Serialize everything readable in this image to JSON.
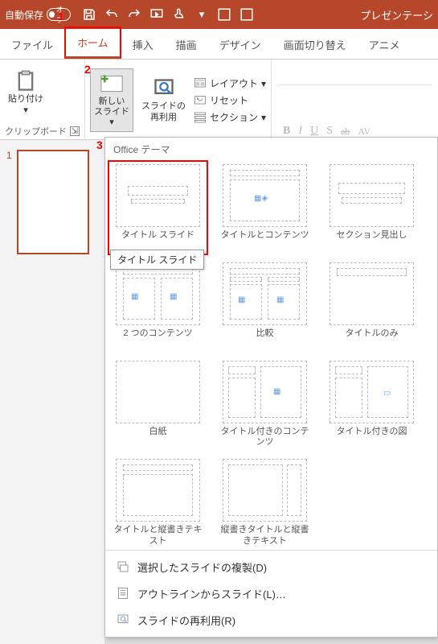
{
  "titlebar": {
    "autosave_label": "自動保存",
    "autosave_state": "オフ",
    "presentation_label": "プレゼンテーシ"
  },
  "callouts": {
    "c1": "1",
    "c2": "2",
    "c3": "3"
  },
  "tabs": {
    "file": "ファイル",
    "home": "ホーム",
    "insert": "挿入",
    "draw": "描画",
    "design": "デザイン",
    "transitions": "画面切り替え",
    "animations": "アニメ"
  },
  "ribbon": {
    "clipboard": {
      "title": "クリップボード",
      "paste": "貼り付け"
    },
    "slides": {
      "new_slide": "新しい\nスライド",
      "reuse": "スライドの\n再利用",
      "layout": "レイアウト",
      "reset": "リセット",
      "section": "セクション"
    },
    "font": {
      "b": "B",
      "i": "I",
      "u": "U",
      "s": "S",
      "ab": "ab",
      "av": "AV"
    }
  },
  "slide_panel": {
    "num": "1"
  },
  "gallery": {
    "header": "Office テーマ",
    "tooltip": "タイトル スライド",
    "layouts": [
      {
        "id": "title-slide",
        "label": "タイトル スライド"
      },
      {
        "id": "title-content",
        "label": "タイトルとコンテンツ"
      },
      {
        "id": "section-header",
        "label": "セクション見出し"
      },
      {
        "id": "two-content",
        "label": "2 つのコンテンツ"
      },
      {
        "id": "comparison",
        "label": "比較"
      },
      {
        "id": "title-only",
        "label": "タイトルのみ"
      },
      {
        "id": "blank",
        "label": "白紙"
      },
      {
        "id": "content-caption",
        "label": "タイトル付きのコンテンツ"
      },
      {
        "id": "picture-caption",
        "label": "タイトル付きの図"
      },
      {
        "id": "title-vertical",
        "label": "タイトルと縦書きテキスト"
      },
      {
        "id": "vertical-title",
        "label": "縦書きタイトルと縦書きテキスト"
      }
    ],
    "footer": {
      "duplicate": "選択したスライドの複製(D)",
      "outline": "アウトラインからスライド(L)…",
      "reuse": "スライドの再利用(R)"
    }
  }
}
